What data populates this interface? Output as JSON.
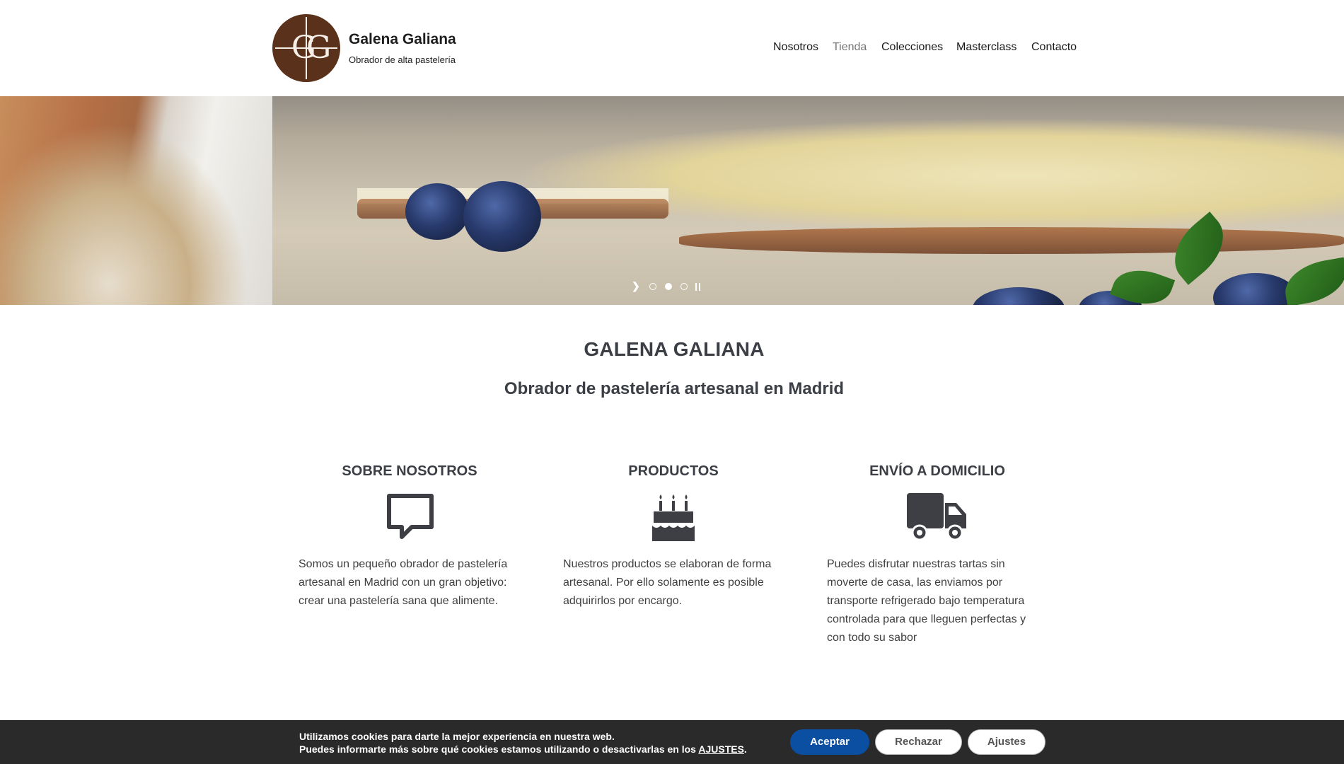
{
  "brand": {
    "monogram": "GG",
    "title": "Galena Galiana",
    "subtitle": "Obrador de alta pastelería"
  },
  "nav": [
    {
      "label": "Nosotros",
      "active": false
    },
    {
      "label": "Tienda",
      "active": true
    },
    {
      "label": "Colecciones",
      "active": false
    },
    {
      "label": "Masterclass",
      "active": false
    },
    {
      "label": "Contacto",
      "active": false
    }
  ],
  "slider": {
    "next_icon": "chevron-right-icon",
    "dots": 3,
    "active_dot": 2,
    "pause_icon": "pause-icon"
  },
  "hero_heading": "GALENA GALIANA",
  "hero_subheading": "Obrador de pastelería artesanal en Madrid",
  "features": [
    {
      "title": "SOBRE NOSOTROS",
      "icon": "speech-bubble-icon",
      "text": "Somos un pequeño obrador de pastelería artesanal en Madrid con un gran objetivo: crear una pastelería sana que alimente."
    },
    {
      "title": "PRODUCTOS",
      "icon": "birthday-cake-icon",
      "text": "Nuestros productos se elaboran de forma artesanal. Por ello solamente es posible adquirirlos por encargo."
    },
    {
      "title": "ENVÍO A DOMICILIO",
      "icon": "truck-icon",
      "text": "Puedes disfrutar nuestras tartas sin moverte de casa, las enviamos por transporte refrigerado bajo temperatura controlada para que lleguen perfectas y con todo su sabor"
    }
  ],
  "cookie": {
    "line1": "Utilizamos cookies para darte la mejor experiencia en nuestra web.",
    "line2_prefix": "Puedes informarte más sobre qué cookies estamos utilizando o desactivarlas en los ",
    "line2_link": "AJUSTES",
    "line2_suffix": ".",
    "accept_label": "Aceptar",
    "reject_label": "Rechazar",
    "settings_label": "Ajustes"
  },
  "colors": {
    "logo_bg": "#5a311a",
    "accept_button": "#0b4fa3",
    "cookie_bar": "#2a2a2a",
    "heading": "#3b3f45"
  }
}
